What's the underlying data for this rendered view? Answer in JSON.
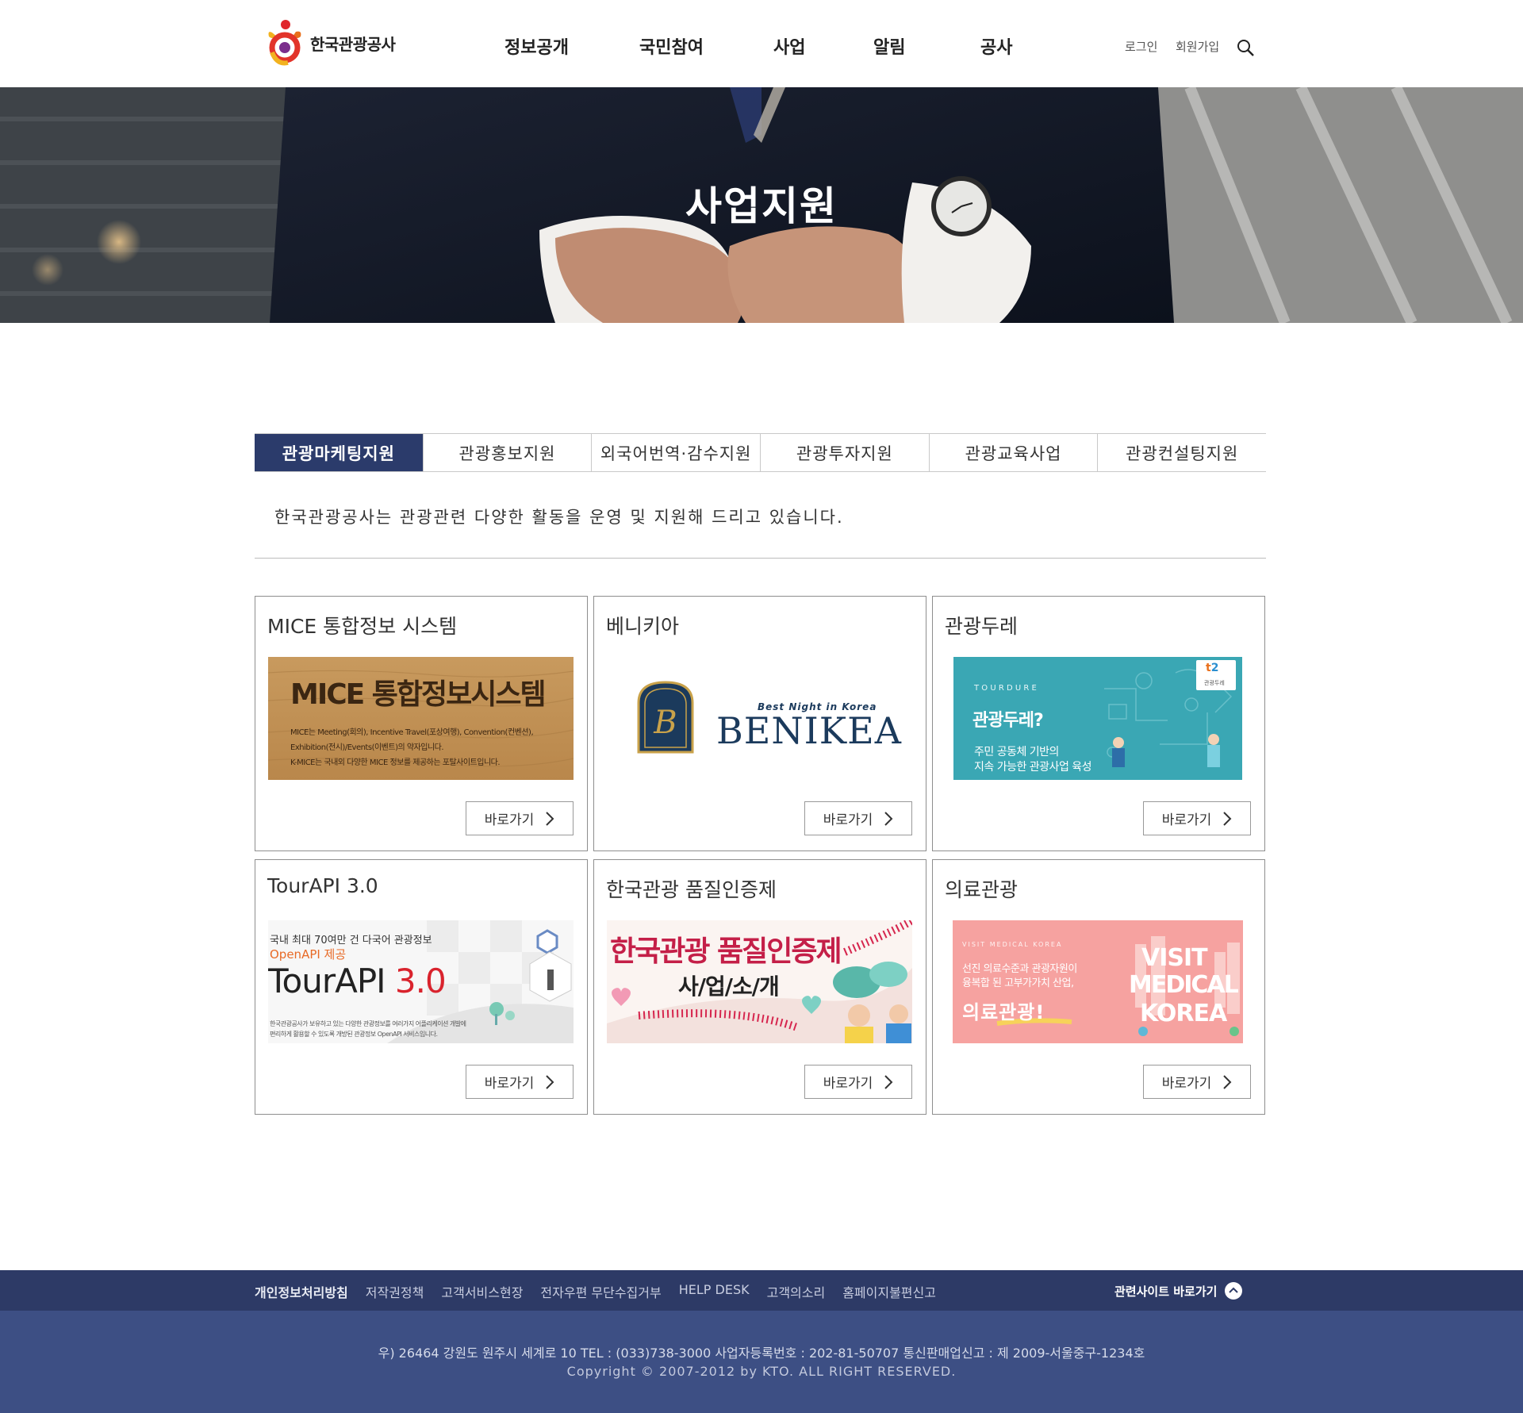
{
  "header": {
    "logo_text": "한국관광공사",
    "nav": [
      "정보공개",
      "국민참여",
      "사업",
      "알림",
      "공사"
    ],
    "login": "로그인",
    "signup": "회원가입"
  },
  "hero": {
    "title": "사업지원"
  },
  "tabs": [
    "관광마케팅지원",
    "관광홍보지원",
    "외국어번역·감수지원",
    "관광투자지원",
    "관광교육사업",
    "관광컨설팅지원"
  ],
  "intro": "한국관광공사는 관광관련 다양한 활동을 운영 및 지원해 드리고 있습니다.",
  "cards": [
    {
      "title": "MICE 통합정보 시스템",
      "button": "바로가기",
      "banner": {
        "headline": "MICE 통합정보시스템",
        "line1": "MICE는 Meeting(회의), Incentive Travel(포상여행), Convention(컨벤션),",
        "line2": "Exhibition(전시)/Events(이벤트)의 약자입니다.",
        "line3": "K-MICE는 국내외 다양한 MICE 정보를 제공하는 포탈사이트입니다."
      }
    },
    {
      "title": "베니키아",
      "button": "바로가기",
      "banner": {
        "tagline": "Best Night in Korea",
        "brand": "BENIKEA"
      }
    },
    {
      "title": "관광두레",
      "button": "바로가기",
      "banner": {
        "eyebrow": "T O U R D U R E",
        "headline": "관광두레?",
        "line1": "주민 공동체 기반의",
        "line2": "지속 가능한 관광사업 육성",
        "badge": "관광두레"
      }
    },
    {
      "title": "TourAPI 3.0",
      "button": "바로가기",
      "banner": {
        "line1": "국내 최대 70여만 건 다국어 관광정보",
        "line2": "OpenAPI 제공",
        "brand": "TourAPI",
        "version": "3.0",
        "small1": "한국관광공사가 보유하고 있는 다양한 관광정보를 여러가지 어플리케이션 개발에",
        "small2": "편리하게 활용할 수 있도록 개방된 관광정보 OpenAPI 서비스입니다."
      }
    },
    {
      "title": "한국관광 품질인증제",
      "button": "바로가기",
      "banner": {
        "headline": "한국관광 품질인증제",
        "sub": "사/업/소/개"
      }
    },
    {
      "title": "의료관광",
      "button": "바로가기",
      "banner": {
        "eyebrow": "VISIT MEDICAL KOREA",
        "line1": "선진 의료수준과 관광자원이",
        "line2": "융복합 된 고부가가치 산업,",
        "headline": "의료관광!",
        "logo1": "VISIT",
        "logo2": "MEDICAL",
        "logo3": "KOREA"
      }
    }
  ],
  "footer": {
    "links": [
      "개인정보처리방침",
      "저작권정책",
      "고객서비스현장",
      "전자우편 무단수집거부",
      "HELP DESK",
      "고객의소리",
      "홈페이지불편신고"
    ],
    "related": "관련사이트 바로가기",
    "address": "우) 26464 강원도 원주시 세계로 10 TEL : (033)738-3000 사업자등록번호 : 202-81-50707 통신판매업신고 : 제 2009-서울중구-1234호",
    "copyright": "Copyright © 2007-2012 by KTO. ALL RIGHT RESERVED."
  },
  "colors": {
    "tab_active": "#2b3b6b",
    "footer_top": "#2d3a66",
    "footer_bottom": "#3d4f84",
    "tourdure_bg": "#3aa7b4",
    "medical_bg": "#f6a2a0",
    "benikea_navy": "#1b3a5c"
  },
  "icons": [
    "search-icon",
    "chevron-right-icon",
    "chevron-up-icon"
  ]
}
